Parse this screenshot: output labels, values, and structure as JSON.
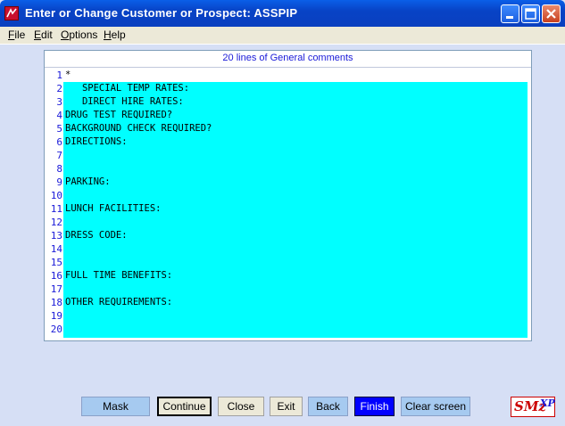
{
  "window": {
    "title": "Enter or Change Customer or Prospect:  ASSPIP",
    "icons": [
      "app-icon",
      "minimize-icon",
      "maximize-icon",
      "close-icon"
    ]
  },
  "menu": {
    "items": [
      "File",
      "Edit",
      "Options",
      "Help"
    ],
    "mnemonics": [
      "F",
      "E",
      "O",
      "H"
    ]
  },
  "panel": {
    "header": "20 lines of General comments"
  },
  "editor": {
    "lines": [
      {
        "num": "1",
        "text": "*"
      },
      {
        "num": "2",
        "text": "   SPECIAL TEMP RATES:"
      },
      {
        "num": "3",
        "text": "   DIRECT HIRE RATES:"
      },
      {
        "num": "4",
        "text": "DRUG TEST REQUIRED?"
      },
      {
        "num": "5",
        "text": "BACKGROUND CHECK REQUIRED?"
      },
      {
        "num": "6",
        "text": "DIRECTIONS:"
      },
      {
        "num": "7",
        "text": ""
      },
      {
        "num": "8",
        "text": ""
      },
      {
        "num": "9",
        "text": "PARKING:"
      },
      {
        "num": "10",
        "text": ""
      },
      {
        "num": "11",
        "text": "LUNCH FACILITIES:"
      },
      {
        "num": "12",
        "text": ""
      },
      {
        "num": "13",
        "text": "DRESS CODE:"
      },
      {
        "num": "14",
        "text": ""
      },
      {
        "num": "15",
        "text": ""
      },
      {
        "num": "16",
        "text": "FULL TIME BENEFITS:"
      },
      {
        "num": "17",
        "text": ""
      },
      {
        "num": "18",
        "text": "OTHER REQUIREMENTS:"
      },
      {
        "num": "19",
        "text": ""
      },
      {
        "num": "20",
        "text": ""
      }
    ]
  },
  "buttons": {
    "mask": "Mask",
    "continue": "Continue",
    "close": "Close",
    "exit": "Exit",
    "back": "Back",
    "finish": "Finish",
    "clear": "Clear screen"
  },
  "logo": {
    "text": "SMz",
    "sup": "XP"
  },
  "colors": {
    "editor_bg": "#00ffff",
    "line_numbers": "#1a1ad8",
    "finish_button": "#0000ff",
    "titlebar": "#0843c6"
  }
}
